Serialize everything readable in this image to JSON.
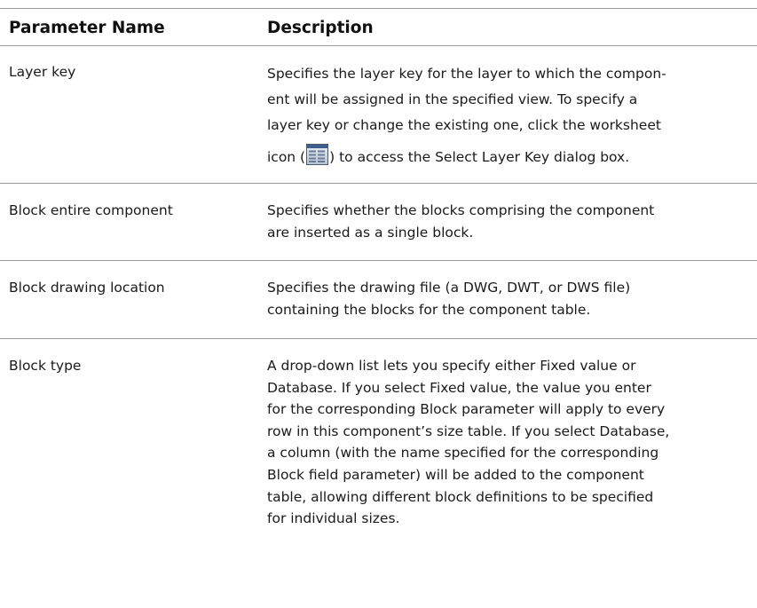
{
  "table": {
    "headers": {
      "parameter_name": "Parameter Name",
      "description": "Description"
    },
    "rows": [
      {
        "name": "Layer key",
        "desc_lines": [
          "Specifies the layer key for the layer to which the compon-",
          "ent will be assigned in the specified view. To specify a",
          "layer key or change the existing one, click the worksheet"
        ],
        "icon_line_before": "icon (",
        "icon_line_after": ") to access the Select Layer Key dialog box.",
        "icon": "worksheet-icon"
      },
      {
        "name": "Block entire component",
        "desc_lines": [
          "Specifies whether the blocks comprising the component",
          "are inserted as a single block."
        ]
      },
      {
        "name": "Block drawing location",
        "desc_lines": [
          "Specifies the drawing file (a DWG, DWT, or DWS file)",
          "containing the blocks for the component table."
        ]
      },
      {
        "name": "Block type",
        "desc_lines": [
          "A drop-down list lets you specify either Fixed value or",
          "Database. If you select Fixed value, the value you enter",
          "for the corresponding Block parameter will apply to every",
          "row in this component’s size table. If you select Database,",
          "a column (with the name specified for the corresponding",
          "Block field parameter) will be added to the component",
          "table, allowing different block definitions to be specified",
          "for individual sizes."
        ]
      }
    ]
  }
}
